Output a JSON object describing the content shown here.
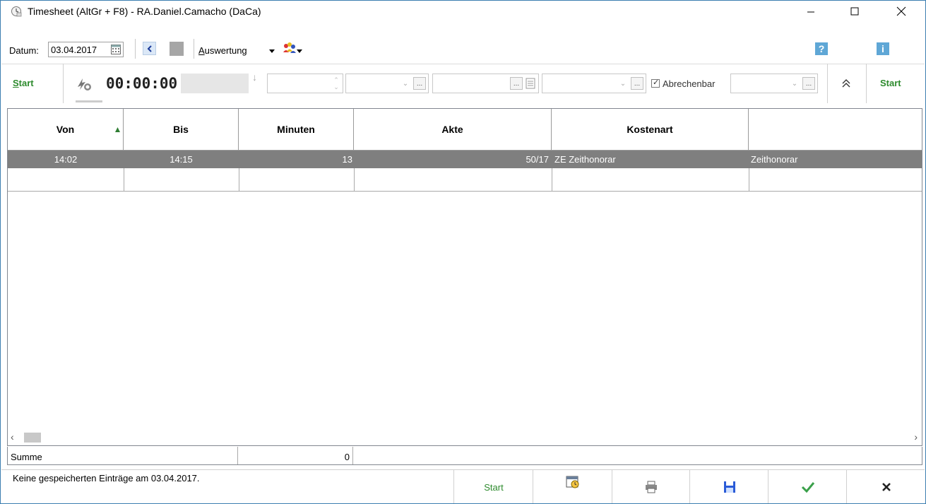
{
  "window": {
    "title": "Timesheet (AltGr + F8)  - RA.Daniel.Camacho (DaCa)",
    "minimize_icon": "minimize-icon",
    "maximize_icon": "maximize-icon",
    "close_icon": "close-icon"
  },
  "toolbar": {
    "datum_label": "Datum:",
    "date_value": "03.04.2017",
    "auswertung_label": "Auswertung",
    "help_label": "?",
    "info_label": "i"
  },
  "timer_bar": {
    "start_left": "Start",
    "timer_value": "00:00:00",
    "abrechenbar_label": "Abrechenbar",
    "abrechenbar_checked": true,
    "start_right": "Start"
  },
  "grid": {
    "columns": [
      "Von",
      "Bis",
      "Minuten",
      "Akte",
      "Kostenart",
      ""
    ],
    "rows": [
      {
        "von": "14:02",
        "bis": "14:15",
        "minuten": "13",
        "akte": "50/17",
        "kostenart": "ZE  Zeithonorar",
        "extra": "Zeithonorar"
      }
    ]
  },
  "summary": {
    "label": "Summe",
    "value": "0"
  },
  "status": {
    "message": "Keine gespeicherten Einträge am 03.04.2017."
  },
  "bottom_buttons": {
    "start_label": "Start"
  },
  "colors": {
    "accent_green": "#2e8b2e",
    "selected_row": "#7f7f7f",
    "window_border": "#3c7fb1",
    "info_blue": "#5fa7d6"
  }
}
